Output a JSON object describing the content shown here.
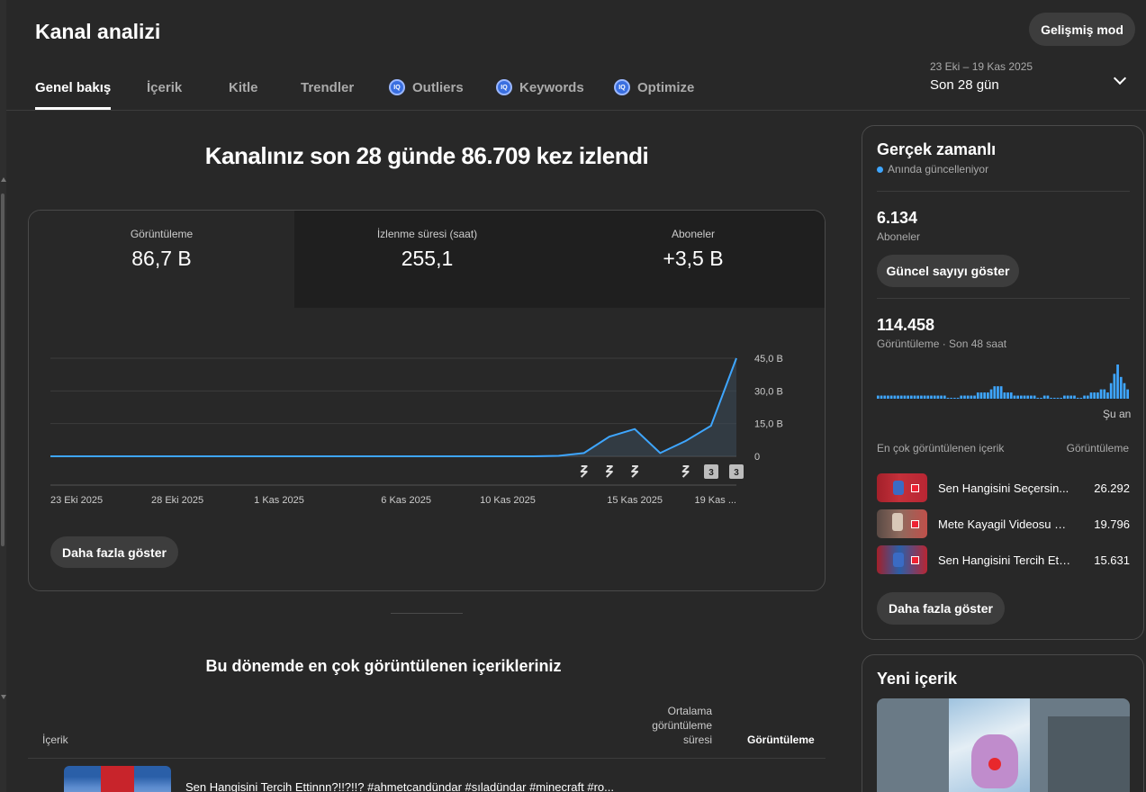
{
  "header": {
    "title": "Kanal analizi",
    "advanced_button": "Gelişmiş mod"
  },
  "tabs": [
    {
      "label": "Genel bakış",
      "active": true,
      "iq": false
    },
    {
      "label": "İçerik",
      "active": false,
      "iq": false
    },
    {
      "label": "Kitle",
      "active": false,
      "iq": false
    },
    {
      "label": "Trendler",
      "active": false,
      "iq": false
    },
    {
      "label": "Outliers",
      "active": false,
      "iq": true
    },
    {
      "label": "Keywords",
      "active": false,
      "iq": true
    },
    {
      "label": "Optimize",
      "active": false,
      "iq": true
    }
  ],
  "iq_badge": "IQ",
  "date_range": {
    "sub": "23 Eki – 19 Kas 2025",
    "main": "Son 28 gün"
  },
  "headline": "Kanalınız son 28 günde 86.709 kez izlendi",
  "metrics": [
    {
      "label": "Görüntüleme",
      "value": "86,7 B",
      "selected": true
    },
    {
      "label": "İzlenme süresi (saat)",
      "value": "255,1",
      "selected": false
    },
    {
      "label": "Aboneler",
      "value": "+3,5 B",
      "selected": false
    }
  ],
  "chart_data": {
    "type": "line",
    "title": "",
    "series_color": "#3ea6ff",
    "x_tick_labels": [
      "23 Eki 2025",
      "28 Eki 2025",
      "1 Kas 2025",
      "6 Kas 2025",
      "10 Kas 2025",
      "15 Kas 2025",
      "19 Kas ..."
    ],
    "y_tick_labels": [
      "45,0 B",
      "30,0 B",
      "15,0 B",
      "0"
    ],
    "y_ticks": [
      45000,
      30000,
      15000,
      0
    ],
    "ylim": [
      0,
      45000
    ],
    "x": [
      "23 Eki",
      "24 Eki",
      "25 Eki",
      "26 Eki",
      "27 Eki",
      "28 Eki",
      "29 Eki",
      "30 Eki",
      "31 Eki",
      "1 Kas",
      "2 Kas",
      "3 Kas",
      "4 Kas",
      "5 Kas",
      "6 Kas",
      "7 Kas",
      "8 Kas",
      "9 Kas",
      "10 Kas",
      "11 Kas",
      "12 Kas",
      "13 Kas",
      "14 Kas",
      "15 Kas",
      "16 Kas",
      "17 Kas",
      "18 Kas",
      "19 Kas"
    ],
    "values": [
      0,
      0,
      0,
      0,
      0,
      0,
      0,
      0,
      0,
      0,
      0,
      0,
      0,
      0,
      0,
      0,
      0,
      0,
      0,
      0,
      200,
      1500,
      9000,
      12500,
      1500,
      7000,
      14000,
      45000
    ],
    "marker_days": [
      "13 Kas",
      "14 Kas",
      "15 Kas",
      "17 Kas",
      "18 Kas",
      "19 Kas",
      "20 Kas"
    ],
    "marker_labels": [
      "",
      "",
      "",
      "",
      "",
      "3",
      "3"
    ],
    "grid": true
  },
  "more_button": "Daha fazla göster",
  "top_content": {
    "title": "Bu dönemde en çok görüntülenen içerikleriniz",
    "col_content": "İçerik",
    "col_avg": "Ortalama görüntüleme süresi",
    "col_views": "Görüntüleme",
    "rows": [
      {
        "title": "Sen Hangisini Tercih Ettinnn?!!?!!? #ahmetcandündar #sıladündar #minecraft #ro..."
      }
    ]
  },
  "realtime": {
    "title": "Gerçek zamanlı",
    "live_text": "Anında güncelleniyor",
    "subscribers_value": "6.134",
    "subscribers_label": "Aboneler",
    "show_count_button": "Güncel sayıyı göster",
    "views_value": "114.458",
    "views_label": "Görüntüleme · Son 48 saat",
    "now_label": "Şu an",
    "spark_values": [
      1,
      1,
      1,
      1,
      1,
      1,
      1,
      1,
      1,
      1,
      1,
      1,
      1,
      1,
      1,
      1,
      1,
      1,
      1,
      1,
      1,
      0,
      0,
      0,
      0,
      1,
      1,
      1,
      1,
      1,
      2,
      2,
      2,
      2,
      3,
      4,
      4,
      4,
      2,
      2,
      2,
      1,
      1,
      1,
      1,
      1,
      1,
      1,
      0,
      0,
      1,
      1,
      0,
      0,
      0,
      0,
      1,
      1,
      1,
      1,
      0,
      0,
      1,
      1,
      2,
      2,
      2,
      3,
      3,
      2,
      5,
      8,
      11,
      7,
      5,
      3
    ],
    "top_heading": "En çok görüntülenen içerik",
    "views_heading": "Görüntüleme",
    "items": [
      {
        "title": "Sen Hangisini Seçersin...",
        "views": "26.292"
      },
      {
        "title": "Mete Kayagil Videosu 2 ...",
        "views": "19.796"
      },
      {
        "title": "Sen Hangisini Tercih Ett...",
        "views": "15.631"
      }
    ],
    "more_button": "Daha fazla göster"
  },
  "new_content": {
    "title": "Yeni içerik"
  }
}
